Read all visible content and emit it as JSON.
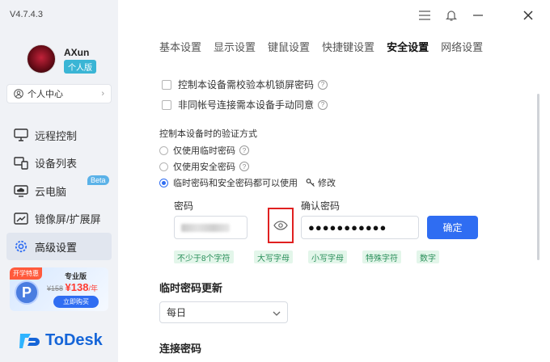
{
  "app": {
    "version": "V4.7.4.3"
  },
  "user": {
    "name": "AXun",
    "tier": "个人版"
  },
  "user_center": {
    "label": "个人中心"
  },
  "nav": {
    "items": [
      {
        "label": "远程控制",
        "icon": "monitor-icon"
      },
      {
        "label": "设备列表",
        "icon": "devices-icon"
      },
      {
        "label": "云电脑",
        "icon": "cloud-pc-icon"
      },
      {
        "label": "镜像屏/扩展屏",
        "icon": "mirror-icon"
      },
      {
        "label": "高级设置",
        "icon": "gear-icon"
      }
    ],
    "beta_badge": "Beta"
  },
  "promo": {
    "tag": "开学特惠",
    "edition": "专业版",
    "old_price": "¥158",
    "new_price": "¥138",
    "unit": "/年",
    "button": "立即购买"
  },
  "logo": {
    "text": "ToDesk"
  },
  "tabs": [
    "基本设置",
    "显示设置",
    "键鼠设置",
    "快捷键设置",
    "安全设置",
    "网络设置"
  ],
  "active_tab": "安全设置",
  "checkboxes": [
    {
      "label": "控制本设备需校验本机锁屏密码",
      "checked": false
    },
    {
      "label": "非同帐号连接需本设备手动同意",
      "checked": false
    }
  ],
  "verify": {
    "title": "控制本设备时的验证方式",
    "options": [
      {
        "label": "仅使用临时密码",
        "selected": false
      },
      {
        "label": "仅使用安全密码",
        "selected": false
      },
      {
        "label": "临时密码和安全密码都可以使用",
        "selected": true
      }
    ],
    "modify_label": "修改"
  },
  "password": {
    "label": "密码",
    "confirm_label": "确认密码",
    "confirm_value": "●●●●●●●●●●●",
    "confirm_button": "确定"
  },
  "rules": [
    "不少于8个字符",
    "大写字母",
    "小写字母",
    "特殊字符",
    "数字"
  ],
  "temp_password": {
    "title": "临时密码更新",
    "selected": "每日"
  },
  "connect_password": {
    "title": "连接密码"
  },
  "colors": {
    "accent": "#2f6df2",
    "highlight": "#e02020",
    "rule_text": "#2a8f5a",
    "rule_bg": "#e3f6ea"
  }
}
